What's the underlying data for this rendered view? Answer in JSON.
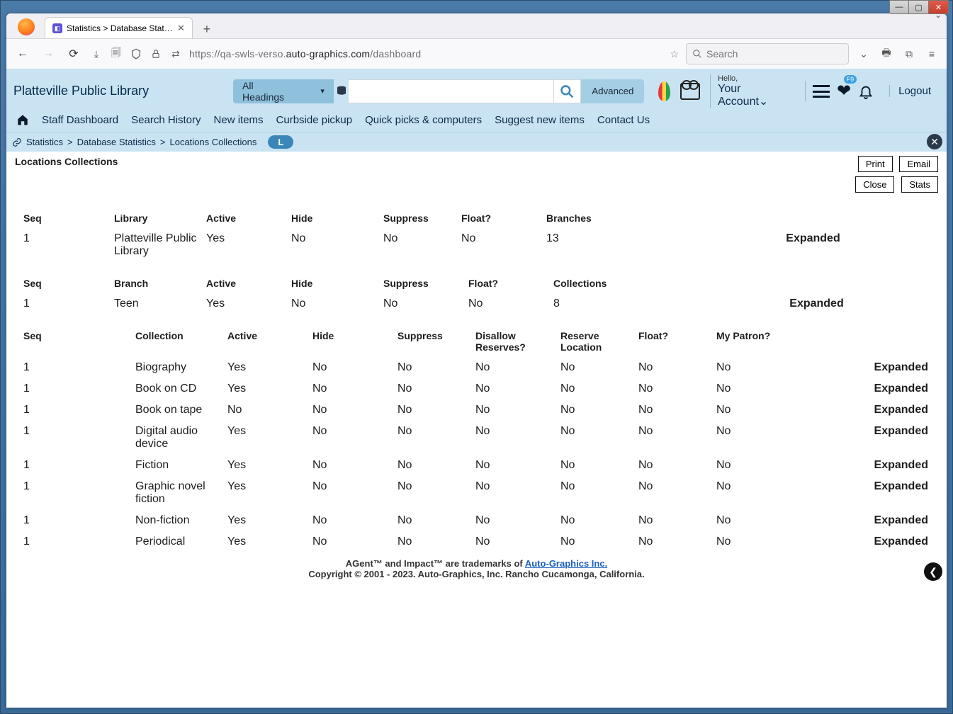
{
  "window": {
    "title": "Statistics > Database Statistics >"
  },
  "browser": {
    "tab_label": "Statistics > Database Statistics >",
    "url_prefix": "https://",
    "url_host_muted": "qa-swls-verso.",
    "url_host_main": "auto-graphics.com",
    "url_path": "/dashboard",
    "search_placeholder": "Search"
  },
  "header": {
    "library_name": "Platteville Public Library",
    "headings_dropdown": "All Headings",
    "advanced": "Advanced",
    "hello": "Hello,",
    "account": "Your Account",
    "heart_badge": "F9",
    "logout": "Logout",
    "nav": [
      "Staff Dashboard",
      "Search History",
      "New items",
      "Curbside pickup",
      "Quick picks & computers",
      "Suggest new items",
      "Contact Us"
    ]
  },
  "breadcrumb": {
    "items": [
      "Statistics",
      "Database Statistics",
      "Locations Collections"
    ],
    "pill": "L"
  },
  "page": {
    "title": "Locations Collections",
    "buttons": [
      "Print",
      "Email",
      "Close",
      "Stats"
    ]
  },
  "level1": {
    "headers": [
      "Seq",
      "Library",
      "Active",
      "Hide",
      "Suppress",
      "Float?",
      "Branches"
    ],
    "row": {
      "seq": "1",
      "library": "Platteville Public Library",
      "active": "Yes",
      "hide": "No",
      "suppress": "No",
      "float": "No",
      "branches": "13",
      "state": "Expanded"
    }
  },
  "level2": {
    "headers": [
      "Seq",
      "Branch",
      "Active",
      "Hide",
      "Suppress",
      "Float?",
      "Collections"
    ],
    "row": {
      "seq": "1",
      "branch": "Teen",
      "active": "Yes",
      "hide": "No",
      "suppress": "No",
      "float": "No",
      "collections": "8",
      "state": "Expanded"
    }
  },
  "level3": {
    "headers": [
      "Seq",
      "Collection",
      "Active",
      "Hide",
      "Suppress",
      "Disallow Reserves?",
      "Reserve Location",
      "Float?",
      "My Patron?"
    ],
    "rows": [
      {
        "seq": "1",
        "collection": "Biography",
        "active": "Yes",
        "hide": "No",
        "suppress": "No",
        "disallow": "No",
        "reserve": "No",
        "float": "No",
        "patron": "No",
        "state": "Expanded"
      },
      {
        "seq": "1",
        "collection": "Book on CD",
        "active": "Yes",
        "hide": "No",
        "suppress": "No",
        "disallow": "No",
        "reserve": "No",
        "float": "No",
        "patron": "No",
        "state": "Expanded"
      },
      {
        "seq": "1",
        "collection": "Book on tape",
        "active": "No",
        "hide": "No",
        "suppress": "No",
        "disallow": "No",
        "reserve": "No",
        "float": "No",
        "patron": "No",
        "state": "Expanded"
      },
      {
        "seq": "1",
        "collection": "Digital audio device",
        "active": "Yes",
        "hide": "No",
        "suppress": "No",
        "disallow": "No",
        "reserve": "No",
        "float": "No",
        "patron": "No",
        "state": "Expanded"
      },
      {
        "seq": "1",
        "collection": "Fiction",
        "active": "Yes",
        "hide": "No",
        "suppress": "No",
        "disallow": "No",
        "reserve": "No",
        "float": "No",
        "patron": "No",
        "state": "Expanded"
      },
      {
        "seq": "1",
        "collection": "Graphic novel fiction",
        "active": "Yes",
        "hide": "No",
        "suppress": "No",
        "disallow": "No",
        "reserve": "No",
        "float": "No",
        "patron": "No",
        "state": "Expanded"
      },
      {
        "seq": "1",
        "collection": "Non-fiction",
        "active": "Yes",
        "hide": "No",
        "suppress": "No",
        "disallow": "No",
        "reserve": "No",
        "float": "No",
        "patron": "No",
        "state": "Expanded"
      },
      {
        "seq": "1",
        "collection": "Periodical",
        "active": "Yes",
        "hide": "No",
        "suppress": "No",
        "disallow": "No",
        "reserve": "No",
        "float": "No",
        "patron": "No",
        "state": "Expanded"
      }
    ]
  },
  "footer": {
    "line1_a": "AGent™ and Impact™ are trademarks of ",
    "line1_link": "Auto-Graphics Inc.",
    "line2": "Copyright © 2001 - 2023. Auto-Graphics, Inc. Rancho Cucamonga, California."
  }
}
